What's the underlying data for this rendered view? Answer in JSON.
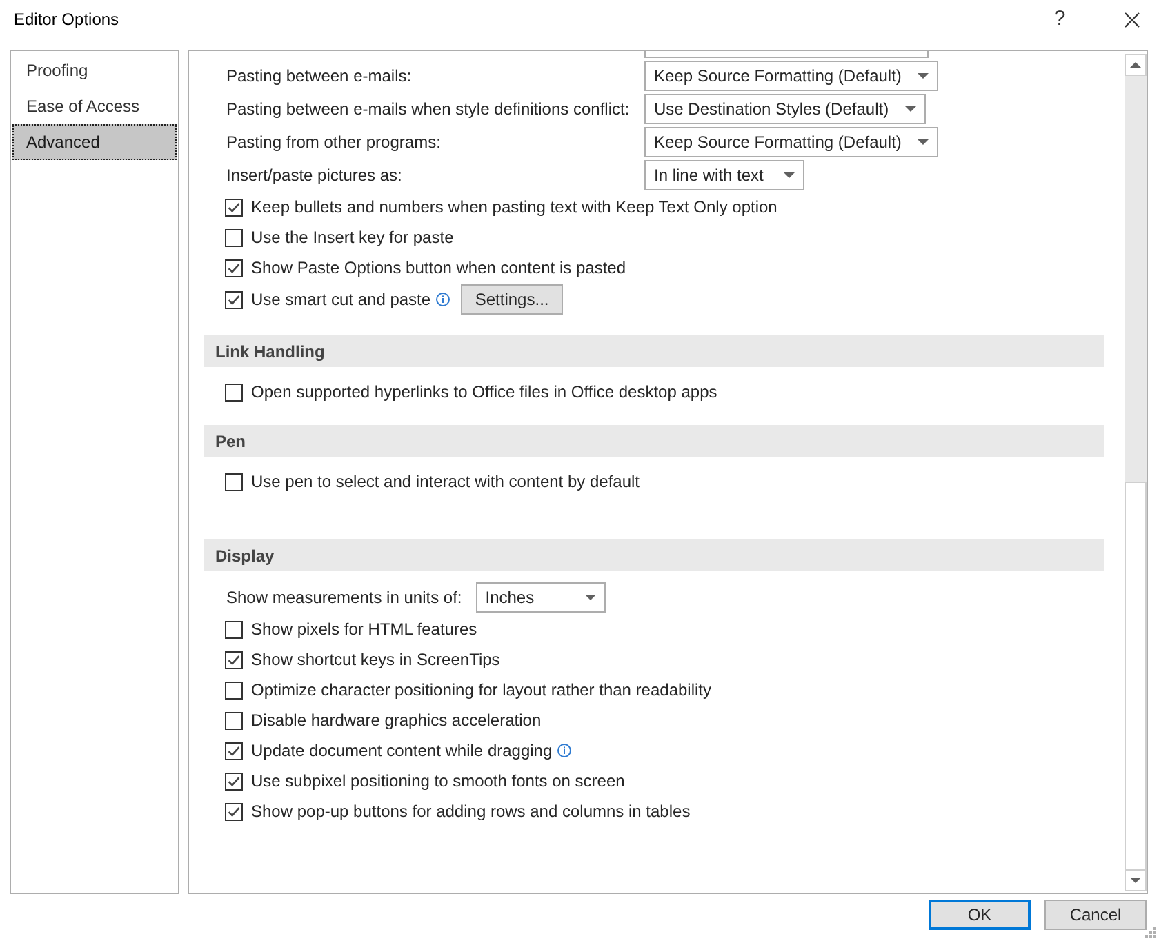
{
  "window": {
    "title": "Editor Options",
    "help_button": "?"
  },
  "sidebar": {
    "items": [
      {
        "label": "Proofing",
        "selected": false
      },
      {
        "label": "Ease of Access",
        "selected": false
      },
      {
        "label": "Advanced",
        "selected": true
      }
    ]
  },
  "options": {
    "sections": [
      {
        "items": [
          {
            "kind": "dropdown",
            "label": "Pasting between e-mails:",
            "value": "Keep Source Formatting (Default)"
          },
          {
            "kind": "dropdown",
            "label": "Pasting between e-mails when style definitions conflict:",
            "value": "Use Destination Styles (Default)"
          },
          {
            "kind": "dropdown",
            "label": "Pasting from other programs:",
            "value": "Keep Source Formatting (Default)"
          },
          {
            "kind": "dropdown",
            "label": "Insert/paste pictures as:",
            "value": "In line with text"
          },
          {
            "kind": "checkbox",
            "label": "Keep bullets and numbers when pasting text with Keep Text Only option",
            "checked": true
          },
          {
            "kind": "checkbox",
            "label": "Use the Insert key for paste",
            "checked": false
          },
          {
            "kind": "checkbox",
            "label": "Show Paste Options button when content is pasted",
            "checked": true
          },
          {
            "kind": "checkbox",
            "label": "Use smart cut and paste",
            "checked": true,
            "info": true,
            "button": "Settings..."
          }
        ]
      },
      {
        "heading": "Link Handling",
        "items": [
          {
            "kind": "checkbox",
            "label": "Open supported hyperlinks to Office files in Office desktop apps",
            "checked": false
          }
        ]
      },
      {
        "heading": "Pen",
        "items": [
          {
            "kind": "checkbox",
            "label": "Use pen to select and interact with content by default",
            "checked": false
          }
        ]
      },
      {
        "heading": "Display",
        "items": [
          {
            "kind": "inline_dropdown",
            "label": "Show measurements in units of:",
            "value": "Inches"
          },
          {
            "kind": "checkbox",
            "label": "Show pixels for HTML features",
            "checked": false
          },
          {
            "kind": "checkbox",
            "label": "Show shortcut keys in ScreenTips",
            "checked": true
          },
          {
            "kind": "checkbox",
            "label": "Optimize character positioning for layout rather than readability",
            "checked": false
          },
          {
            "kind": "checkbox",
            "label": "Disable hardware graphics acceleration",
            "checked": false
          },
          {
            "kind": "checkbox",
            "label": "Update document content while dragging",
            "checked": true,
            "info": true
          },
          {
            "kind": "checkbox",
            "label": "Use subpixel positioning to smooth fonts on screen",
            "checked": true
          },
          {
            "kind": "checkbox",
            "label": "Show pop-up buttons for adding rows and columns in tables",
            "checked": true
          }
        ]
      }
    ]
  },
  "buttons": [
    {
      "label": "OK",
      "default": true
    },
    {
      "label": "Cancel",
      "default": false
    }
  ]
}
